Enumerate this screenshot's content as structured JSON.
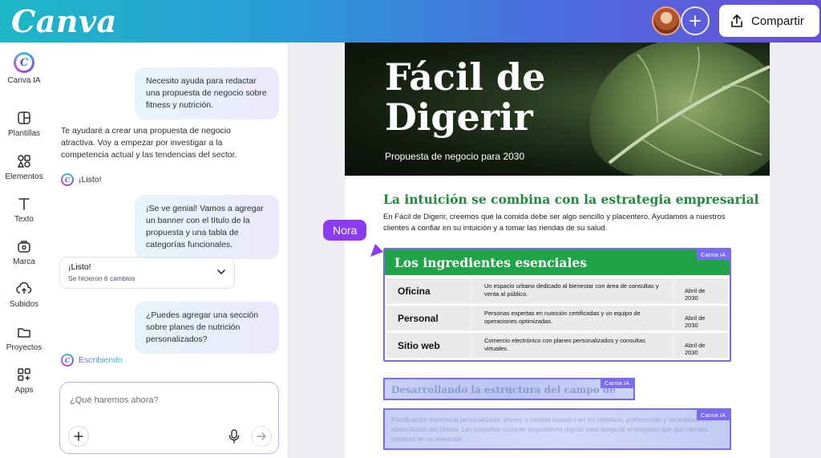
{
  "topbar": {
    "logo": "Canva",
    "share_label": "Compartir"
  },
  "rail": {
    "ai_label": "Canva IA",
    "ai_glyph": "C",
    "items": [
      {
        "label": "Plantillas",
        "icon": "templates-icon"
      },
      {
        "label": "Elementos",
        "icon": "elements-icon"
      },
      {
        "label": "Texto",
        "icon": "text-icon"
      },
      {
        "label": "Marca",
        "icon": "brand-icon"
      },
      {
        "label": "Subidos",
        "icon": "upload-icon"
      },
      {
        "label": "Proyectos",
        "icon": "folder-icon"
      },
      {
        "label": "Apps",
        "icon": "apps-icon"
      }
    ]
  },
  "chat": {
    "msg1": "Necesito ayuda para redactar una propuesta de negocio sobre fitness y nutrición.",
    "reply1": "Te ayudaré a crear una propuesta de negocio atractiva. Voy a empezar por investigar a la competencia actual y las tendencias del sector.",
    "listo1": "¡Listo!",
    "msg2": "¡Se ve genial! Vamos a agregar un banner con el título de la propuesta y una tabla de categorías funcionales.",
    "changes_title": "¡Listo!",
    "changes_sub": "Se hicieron 6 cambios",
    "msg3": "¿Puedes agregar una sección sobre planes de nutrición personalizados?",
    "writing": "Escribiendo",
    "composer_placeholder": "¿Qué haremos ahora?"
  },
  "doc": {
    "hero_title_1": "Fácil de",
    "hero_title_2": "Digerir",
    "hero_subtitle": "Propuesta de negocio para 2030",
    "section_title": "La intuición se combina con la estrategia empresarial",
    "intro": "En Fácil de Digerir, creemos que la comida debe ser algo sencillo y placentero. Ayudamos a nuestros clientes a confiar en su intuición y a tomar las riendas de su salud.",
    "table_title": "Los ingredientes esenciales",
    "ai_tag": "Canva IA",
    "rows": [
      {
        "name": "Oficina",
        "desc": "Un espacio urbano dedicado al bienestar con área de consultas y venta al público.",
        "date": "Abril de 2030"
      },
      {
        "name": "Personal",
        "desc": "Personas expertas en nutrición certificadas y un equipo de operaciones optimizadas.",
        "date": "Abril de 2030"
      },
      {
        "name": "Sitio web",
        "desc": "Comercio electrónico con planes personalizados y consultas virtuales.",
        "date": "Abril de 2030"
      }
    ],
    "ghost_heading": "Desarrollando la estructura del campo de",
    "ghost_text": "Planificación nutricional personalizada: planes a medida basados en los objetivos, preferencias y necesidades de alimentación del cliente. Las consultas incluyen seguimiento regular para asegurar el progreso que sus clientes merecen en su bienestar."
  },
  "collaborator": {
    "name": "Nora",
    "color": "#8b3cf2"
  },
  "colors": {
    "accent": "#7a6cf2",
    "green": "#21a348"
  }
}
